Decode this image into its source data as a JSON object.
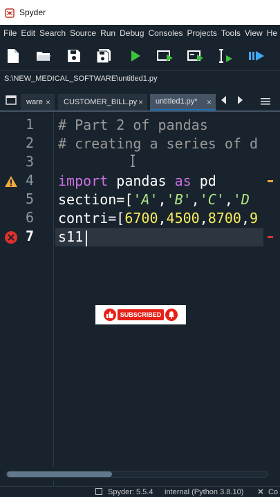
{
  "window": {
    "title": "Spyder"
  },
  "menubar": [
    "File",
    "Edit",
    "Search",
    "Source",
    "Run",
    "Debug",
    "Consoles",
    "Projects",
    "Tools",
    "View",
    "He"
  ],
  "path": "S:\\NEW_MEDICAL_SOFTWARE\\untitled1.py",
  "tabs": [
    {
      "label": "ware",
      "active": false
    },
    {
      "label": "CUSTOMER_BILL.py",
      "active": false
    },
    {
      "label": "untitled1.py*",
      "active": true
    }
  ],
  "tab_close_glyph": "×",
  "editor": {
    "line_numbers": [
      "1",
      "2",
      "3",
      "4",
      "5",
      "6",
      "7"
    ],
    "current_line": 7,
    "lines": [
      [
        {
          "t": "# Part 2 of pandas",
          "c": "cm"
        }
      ],
      [
        {
          "t": "# creating a series of d",
          "c": "cm"
        }
      ],
      [],
      [
        {
          "t": "import",
          "c": "kw"
        },
        {
          "t": " pandas ",
          "c": "id"
        },
        {
          "t": "as",
          "c": "kw"
        },
        {
          "t": " pd",
          "c": "id"
        }
      ],
      [
        {
          "t": "section=[",
          "c": "id"
        },
        {
          "t": "'A'",
          "c": "st"
        },
        {
          "t": ",",
          "c": "id"
        },
        {
          "t": "'B'",
          "c": "st"
        },
        {
          "t": ",",
          "c": "id"
        },
        {
          "t": "'C'",
          "c": "st"
        },
        {
          "t": ",",
          "c": "id"
        },
        {
          "t": "'D",
          "c": "st"
        }
      ],
      [
        {
          "t": "contri=[",
          "c": "id"
        },
        {
          "t": "6700",
          "c": "nm"
        },
        {
          "t": ",",
          "c": "id"
        },
        {
          "t": "4500",
          "c": "nm"
        },
        {
          "t": ",",
          "c": "id"
        },
        {
          "t": "8700",
          "c": "nm"
        },
        {
          "t": ",",
          "c": "id"
        },
        {
          "t": "9",
          "c": "nm"
        }
      ],
      [
        {
          "t": "s11",
          "c": "id"
        }
      ]
    ]
  },
  "subscribe": {
    "label": "SUBSCRIBED"
  },
  "statusbar": {
    "version": "Spyder: 5.5.4",
    "interpreter": "internal (Python 3.8.10)",
    "extra": "Co"
  },
  "colors": {
    "background": "#19232d",
    "comment": "#999999",
    "keyword": "#c670e0",
    "string": "#b0e686",
    "number": "#faed5c",
    "warning": "#f2a93b",
    "error": "#e0312b",
    "accent": "#1a72bb"
  }
}
